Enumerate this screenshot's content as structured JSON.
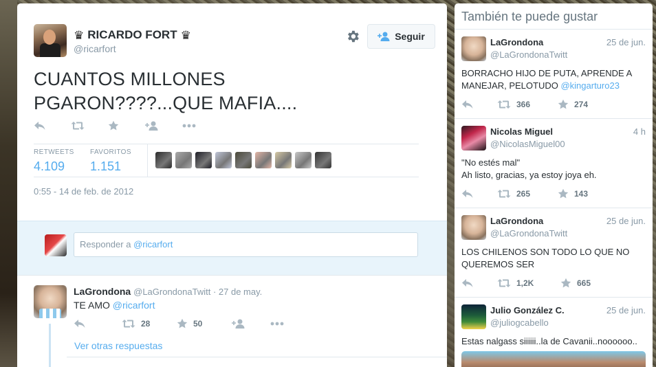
{
  "tweet": {
    "author": {
      "name": "RICARDO FORT",
      "handle": "@ricarfort",
      "crown": "♛"
    },
    "follow_label": "Seguir",
    "text_line1": "CUANTOS MILLONES",
    "text_line2": "PGARON????...QUE MAFIA....",
    "stats": {
      "retweets_label": "RETWEETS",
      "retweets_value": "4.109",
      "favorites_label": "FAVORITOS",
      "favorites_value": "1.151"
    },
    "favorited_by_colors": [
      "#2b2b2b",
      "#a9a9a9",
      "#1e1e26",
      "#c0c6d8",
      "#4b4a3a",
      "#e3b6a6",
      "#d6c9a5",
      "#c8c8c8",
      "#333333"
    ],
    "timestamp": "0:55 - 14 de feb. de 2012"
  },
  "reply_box": {
    "placeholder_prefix": "Responder a ",
    "placeholder_mention": "@ricarfort"
  },
  "reply": {
    "name": "LaGrondona",
    "handle": "@LaGrondonaTwitt",
    "separator": " · ",
    "time": "27 de may.",
    "text_prefix": "TE AMO ",
    "text_mention": "@ricarfort",
    "retweets": "28",
    "favorites": "50",
    "more_replies": "Ver otras respuestas"
  },
  "related": {
    "title": "También te puede gustar",
    "items": [
      {
        "name": "LaGrondona",
        "handle": "@LaGrondonaTwitt",
        "time": "25 de jun.",
        "line1": "BORRACHO HIJO DE PUTA, APRENDE A",
        "line2_prefix": "MANEJAR, PELOTUDO ",
        "line2_mention": "@kingarturo23",
        "retweets": "366",
        "favorites": "274"
      },
      {
        "name": "Nicolas Miguel",
        "handle": "@NicolasMiguel00",
        "time": "4 h",
        "line1": "\"No estés mal\"",
        "line2": "Ah listo, gracias, ya estoy joya eh.",
        "retweets": "265",
        "favorites": "143"
      },
      {
        "name": "LaGrondona",
        "handle": "@LaGrondonaTwitt",
        "time": "25 de jun.",
        "line1": "LOS CHILENOS SON TODO LO QUE NO",
        "line2": "QUEREMOS SER",
        "retweets": "1,2K",
        "favorites": "665"
      },
      {
        "name": "Julio González C.",
        "handle": "@juliogcabello",
        "time": "25 de jun.",
        "line1": "Estas nalgass siiiiii..la de Cavanii..noooooo.."
      }
    ]
  }
}
